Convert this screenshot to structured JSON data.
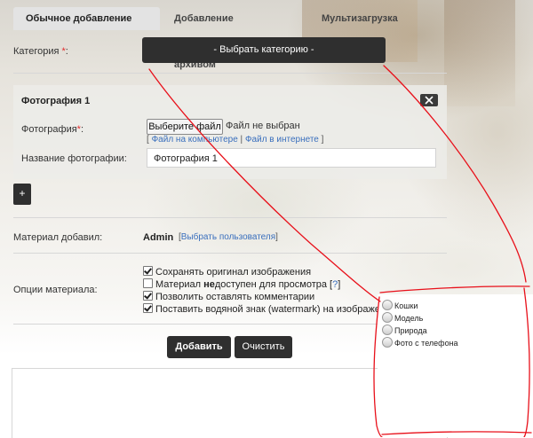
{
  "tabs": [
    {
      "label": "Обычное добавление",
      "active": true
    },
    {
      "label": "Добавление ZIP архивом",
      "active": false
    },
    {
      "label": "Мультизагрузка",
      "active": false
    }
  ],
  "category": {
    "label": "Категория",
    "required_mark": "*",
    "colon": ":",
    "select_label": "- Выбрать категорию -"
  },
  "photo": {
    "title": "Фотография 1",
    "close_icon": "close-icon",
    "file_label": "Фотография",
    "required_mark": "*",
    "colon": ":",
    "file_button": "Выберите файл",
    "file_status": "Файл не выбран",
    "link_computer": "Файл на компьютере",
    "link_internet": "Файл в интернете",
    "name_label": "Название фотографии:",
    "name_value": "Фотография 1"
  },
  "add_more_button": "+",
  "author": {
    "label": "Материал добавил:",
    "name": "Admin",
    "choose_link": "Выбрать пользователя"
  },
  "options": {
    "label": "Опции материала:",
    "items": [
      {
        "label": "Сохранять оригинал изображения",
        "checked": true
      },
      {
        "label_pre": "Материал ",
        "label_bold": "не",
        "label_post": "доступен для просмотра ",
        "help_link": "?",
        "checked": false
      },
      {
        "label": "Позволить оставлять комментарии",
        "checked": true
      },
      {
        "label": "Поставить водяной знак (watermark) на изображение",
        "checked": true
      }
    ]
  },
  "buttons": {
    "submit": "Добавить",
    "reset": "Очистить"
  },
  "category_options": [
    "Кошки",
    "Модель",
    "Природа",
    "Фото с телефона"
  ],
  "colors": {
    "dark_button": "#2f2f2f",
    "link": "#3a6fbd",
    "required": "#e32b2b",
    "annotation": "#e8101a"
  }
}
